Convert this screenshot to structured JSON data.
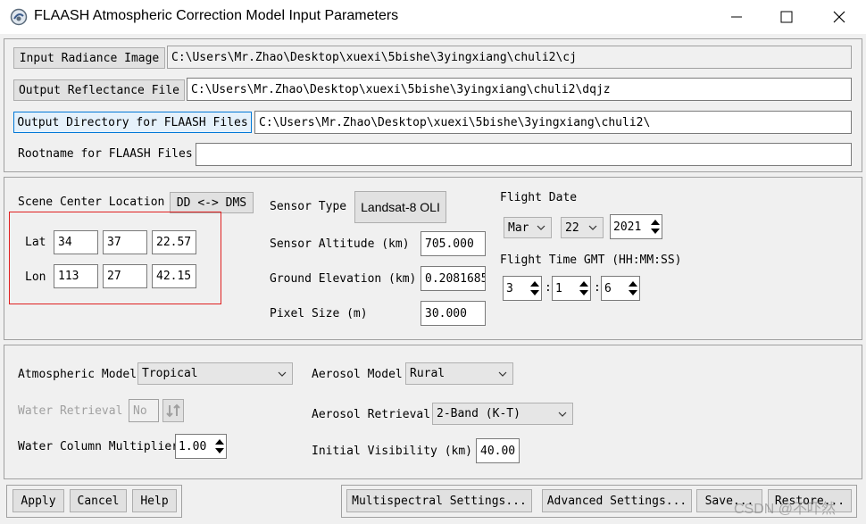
{
  "window": {
    "title": "FLAASH Atmospheric Correction Model Input Parameters"
  },
  "files": {
    "input_radiance_label": "Input Radiance Image",
    "input_radiance_value": "C:\\Users\\Mr.Zhao\\Desktop\\xuexi\\5bishe\\3yingxiang\\chuli2\\cj",
    "output_reflectance_label": "Output Reflectance File",
    "output_reflectance_value": "C:\\Users\\Mr.Zhao\\Desktop\\xuexi\\5bishe\\3yingxiang\\chuli2\\dqjz",
    "output_directory_label": "Output Directory for FLAASH Files",
    "output_directory_value": "C:\\Users\\Mr.Zhao\\Desktop\\xuexi\\5bishe\\3yingxiang\\chuli2\\",
    "rootname_label": "Rootname for FLAASH Files",
    "rootname_value": ""
  },
  "scene": {
    "center_location_label": "Scene Center Location",
    "dd_dms_label": "DD <-> DMS",
    "lat_label": "Lat",
    "lat": [
      "34",
      "37",
      "22.57"
    ],
    "lon_label": "Lon",
    "lon": [
      "113",
      "27",
      "42.15"
    ]
  },
  "sensor": {
    "type_label": "Sensor Type",
    "type_value": "Landsat-8 OLI",
    "altitude_label": "Sensor Altitude (km)",
    "altitude_value": "705.000",
    "ground_elevation_label": "Ground Elevation (km)",
    "ground_elevation_value": "0.2081685",
    "pixel_size_label": "Pixel Size (m)",
    "pixel_size_value": "30.000"
  },
  "flight": {
    "date_label": "Flight Date",
    "month": "Mar",
    "day": "22",
    "year": "2021",
    "time_label": "Flight Time GMT (HH:MM:SS)",
    "hh": "3",
    "mm": "1",
    "ss": "6",
    "sep": ":"
  },
  "atmosphere": {
    "model_label": "Atmospheric Model",
    "model_value": "Tropical",
    "water_retrieval_label": "Water Retrieval",
    "water_retrieval_value": "No",
    "water_column_label": "Water Column Multiplier",
    "water_column_value": "1.00",
    "aerosol_model_label": "Aerosol Model",
    "aerosol_model_value": "Rural",
    "aerosol_retrieval_label": "Aerosol Retrieval",
    "aerosol_retrieval_value": "2-Band (K-T)",
    "initial_visibility_label": "Initial Visibility (km)",
    "initial_visibility_value": "40.00"
  },
  "buttons": {
    "apply": "Apply",
    "cancel": "Cancel",
    "help": "Help",
    "multispectral": "Multispectral Settings...",
    "advanced": "Advanced Settings...",
    "save": "Save...",
    "restore": "Restore..."
  },
  "watermark": "CSDN @不吓然"
}
